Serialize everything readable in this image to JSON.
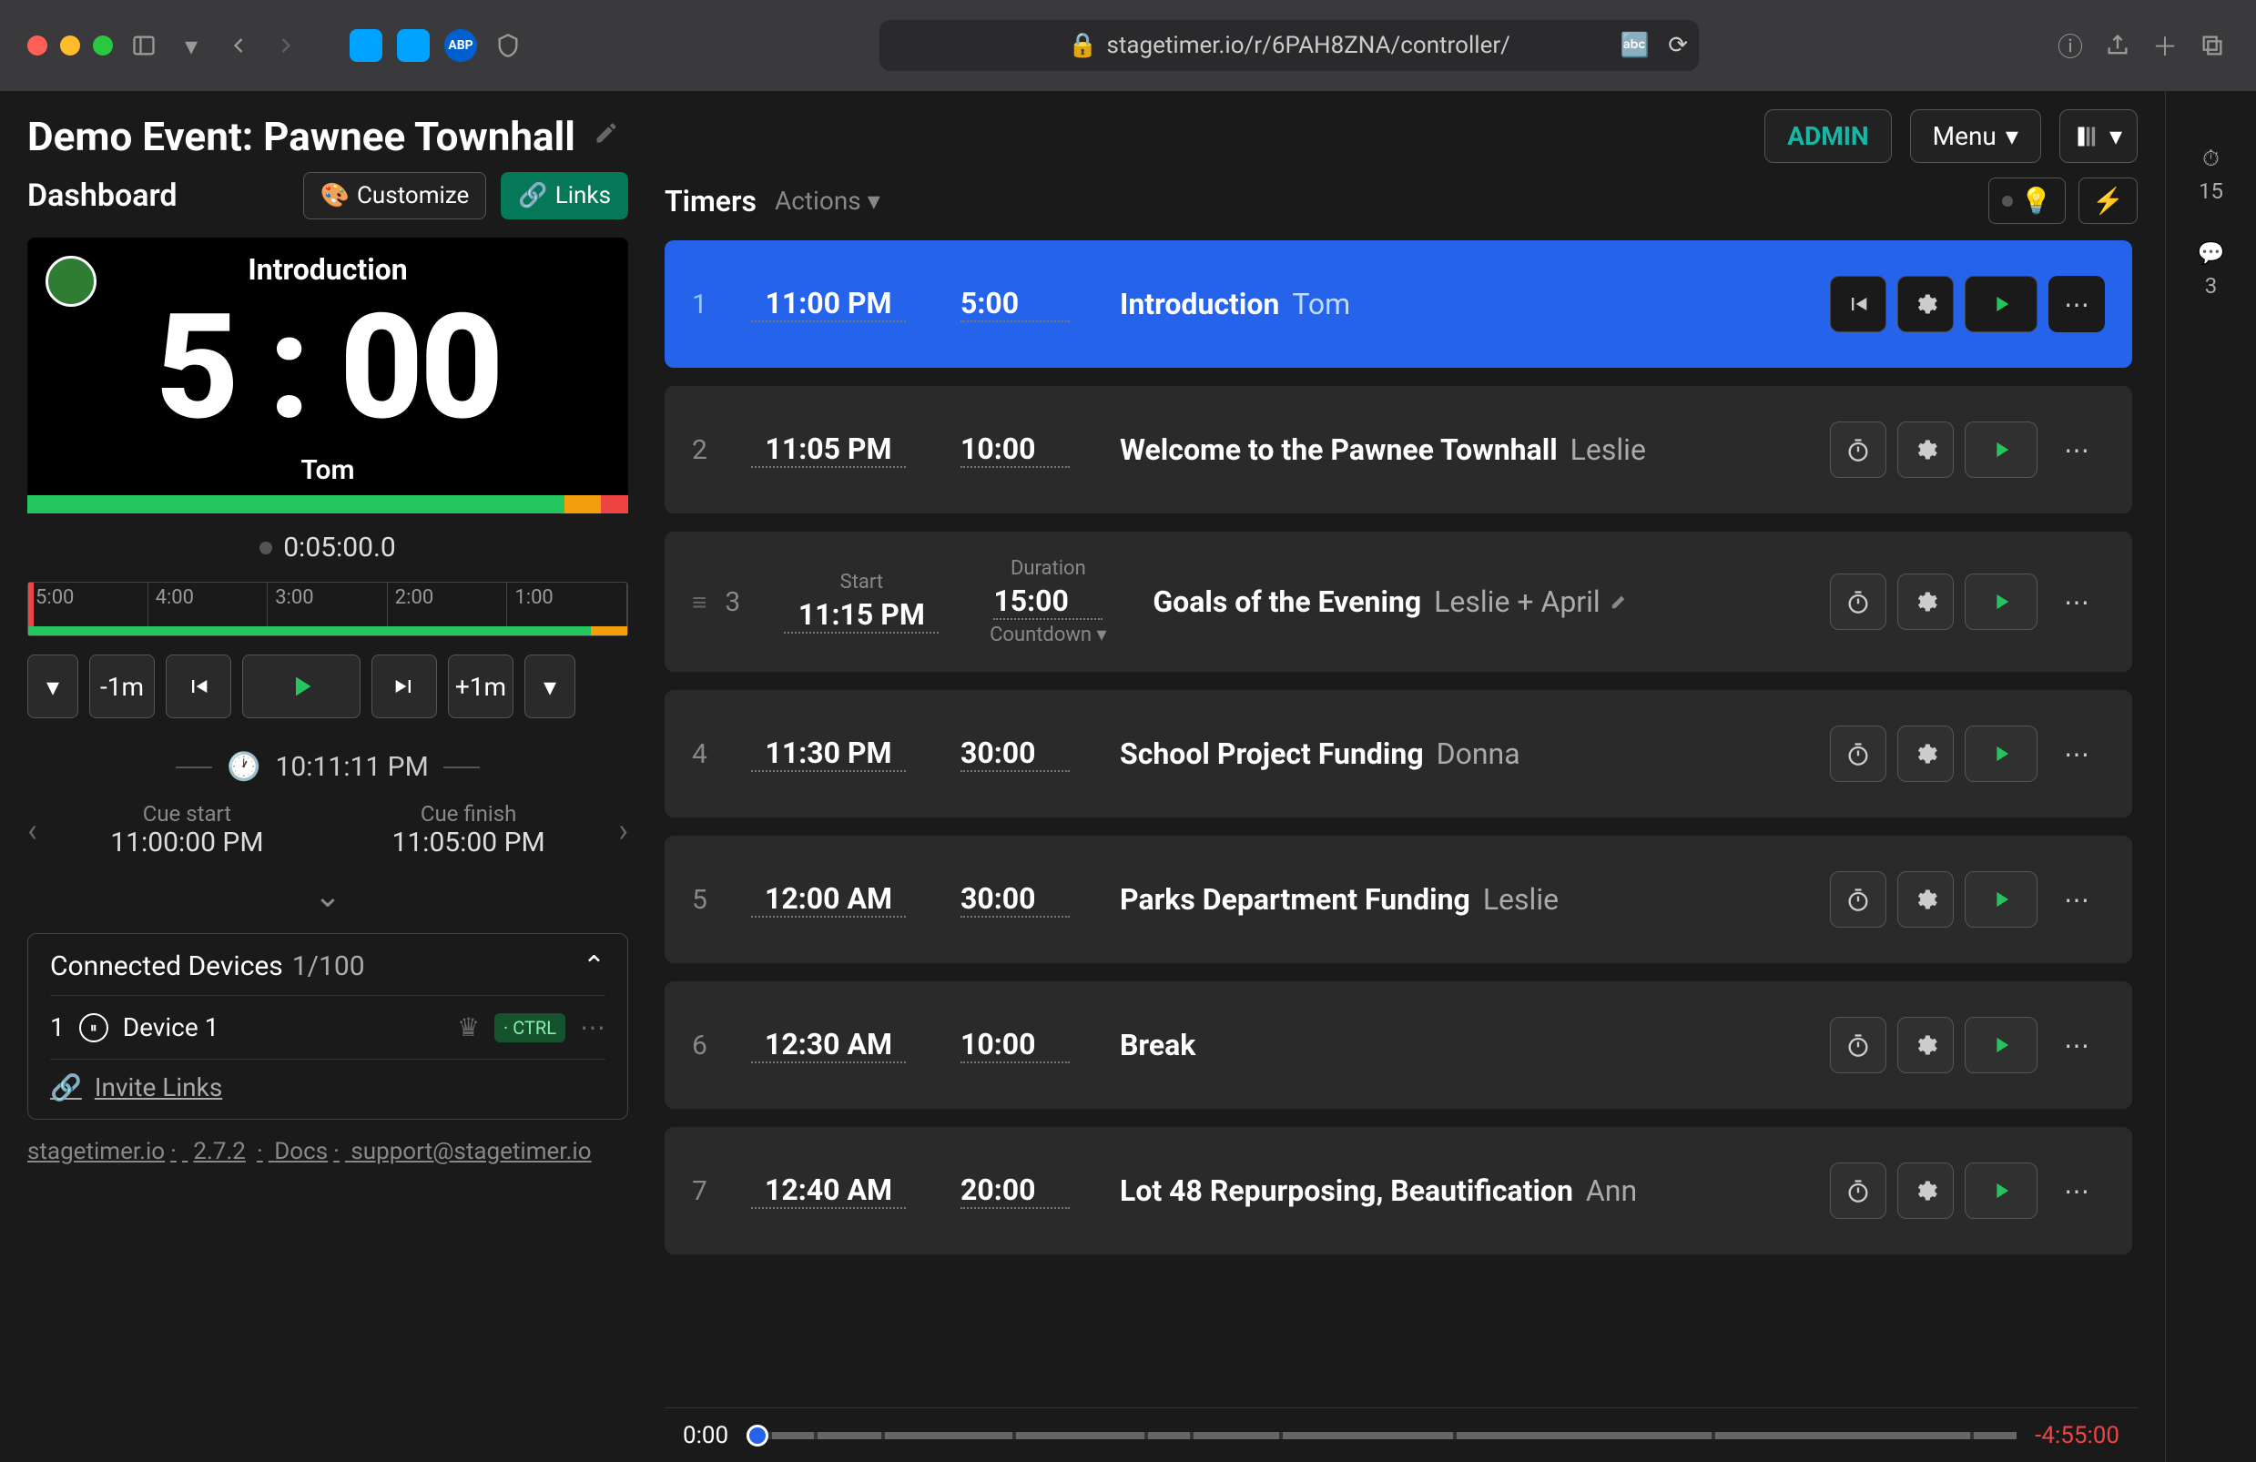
{
  "browser": {
    "url": "stagetimer.io/r/6PAH8ZNA/controller/"
  },
  "header": {
    "title": "Demo Event: Pawnee Townhall",
    "admin": "ADMIN",
    "menu": "Menu"
  },
  "dashboard": {
    "label": "Dashboard",
    "customize": "Customize",
    "links": "Links"
  },
  "preview": {
    "title": "Introduction",
    "time": "5 : 00",
    "speaker": "Tom",
    "readout": "0:05:00.0"
  },
  "ruler": [
    "5:00",
    "4:00",
    "3:00",
    "2:00",
    "1:00"
  ],
  "controls": {
    "minus": "-1m",
    "plus": "+1m"
  },
  "clock": "10:11:11  PM",
  "cue": {
    "start_label": "Cue start",
    "start": "11:00:00  PM",
    "finish_label": "Cue finish",
    "finish": "11:05:00  PM"
  },
  "devices": {
    "title": "Connected Devices",
    "count": "1/100",
    "item_idx": "1",
    "item_name": "Device 1",
    "ctrl": "· CTRL",
    "invite": "Invite Links"
  },
  "footer": {
    "site": "stagetimer.io",
    "version": "2.7.2",
    "docs": "Docs",
    "email": "support@stagetimer.io"
  },
  "timers_head": {
    "title": "Timers",
    "actions": "Actions"
  },
  "rail": {
    "count1": "15",
    "count2": "3"
  },
  "timers": [
    {
      "idx": "1",
      "start": "11:00 PM",
      "dur": "5:00",
      "title": "Introduction",
      "speaker": "Tom",
      "active": true,
      "first_icon": "prev"
    },
    {
      "idx": "2",
      "start": "11:05 PM",
      "dur": "10:00",
      "title": "Welcome to the Pawnee Townhall",
      "speaker": "Leslie"
    },
    {
      "idx": "3",
      "start": "11:15 PM",
      "dur": "15:00",
      "title": "Goals of the Evening",
      "speaker": "Leslie + April",
      "labels": true,
      "countdown": "Countdown",
      "start_lbl": "Start",
      "dur_lbl": "Duration",
      "edit": true,
      "drag": true
    },
    {
      "idx": "4",
      "start": "11:30 PM",
      "dur": "30:00",
      "title": "School Project Funding",
      "speaker": "Donna"
    },
    {
      "idx": "5",
      "start": "12:00 AM",
      "dur": "30:00",
      "title": "Parks Department Funding",
      "speaker": "Leslie"
    },
    {
      "idx": "6",
      "start": "12:30 AM",
      "dur": "10:00",
      "title": "Break",
      "speaker": ""
    },
    {
      "idx": "7",
      "start": "12:40 AM",
      "dur": "20:00",
      "title": "Lot 48 Repurposing, Beautification",
      "speaker": "Ann"
    }
  ],
  "timeline": {
    "left": "0:00",
    "right": "-4:55:00"
  }
}
